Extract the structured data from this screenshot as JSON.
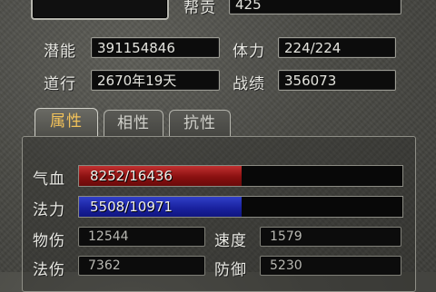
{
  "top": {
    "gang_label": "帮贡",
    "gang_value": "425"
  },
  "info": {
    "potential_label": "潜能",
    "potential_value": "391154846",
    "stamina_label": "体力",
    "stamina_value": "224/224",
    "daoxing_label": "道行",
    "daoxing_value": "2670年19天",
    "record_label": "战绩",
    "record_value": "356073"
  },
  "tabs": [
    {
      "label": "属性",
      "active": true
    },
    {
      "label": "相性",
      "active": false
    },
    {
      "label": "抗性",
      "active": false
    }
  ],
  "stats": {
    "hp_label": "气血",
    "hp_text": "8252/16436",
    "hp_current": 8252,
    "hp_max": 16436,
    "hp_color": "#a01818",
    "mp_label": "法力",
    "mp_text": "5508/10971",
    "mp_current": 5508,
    "mp_max": 10971,
    "mp_color": "#1a22a0",
    "phys_dmg_label": "物伤",
    "phys_dmg_value": "12544",
    "speed_label": "速度",
    "speed_value": "1579",
    "mag_dmg_label": "法伤",
    "mag_dmg_value": "7362",
    "defense_label": "防御",
    "defense_value": "5230"
  }
}
